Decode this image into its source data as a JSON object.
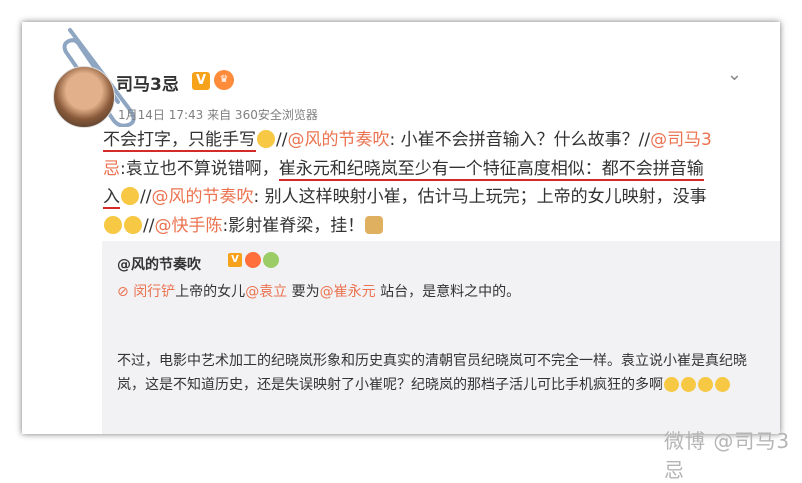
{
  "post": {
    "username": "司马3忌",
    "verified_label": "V",
    "timestamp": "1月14日 17:43 来自 360安全浏览器",
    "line1_part1": "不会打字，只能手写",
    "line1_part2": "//",
    "mention1": "@风的节奏吹",
    "line1_part3": ": 小崔不会拼音输入？什么故事？//",
    "mention2": "@司马3",
    "line2_mention_cont": "忌",
    "line2_part1": ":袁立也不算说错啊，",
    "line2_underlined": "崔永元和纪晓岚至少有一个特征高度相似：都不会拼音输",
    "line3_underlined": "入",
    "line3_part1": "//",
    "mention3": "@风的节奏吹",
    "line3_part2": ": 别人这样映射小崔，估计马上玩完；上帝的女儿映射，没事",
    "line4_part1": "//",
    "mention4": "@快手陈",
    "line4_part2": ":影射崔脊梁，挂！"
  },
  "quote": {
    "author": "@风的节奏吹",
    "verified_label": "V",
    "line_prefix": "⊘ ",
    "mention_a": "闵行铲",
    "line_text1": "上帝的女儿",
    "mention_b": "@袁立",
    "line_text2": "要为",
    "mention_c": "@崔永元",
    "line_text3": "站台，是意料之中的。",
    "paragraph": "不过，电影中艺术加工的纪晓岚形象和历史真实的清朝官员纪晓岚可不完全一样。袁立说小崔是真纪晓岚，这是不知道历史，还是失误映射了小崔呢？纪晓岚的那档子活儿可比手机疯狂的多啊"
  },
  "watermark": "微博 @司马3忌",
  "icons": [
    "paperclip-icon",
    "chevron-down-icon",
    "crown-icon",
    "emoji-icon"
  ],
  "colors": {
    "mention": "#eb7350",
    "underline": "#d42a2a",
    "verified": "#f7a21b"
  }
}
